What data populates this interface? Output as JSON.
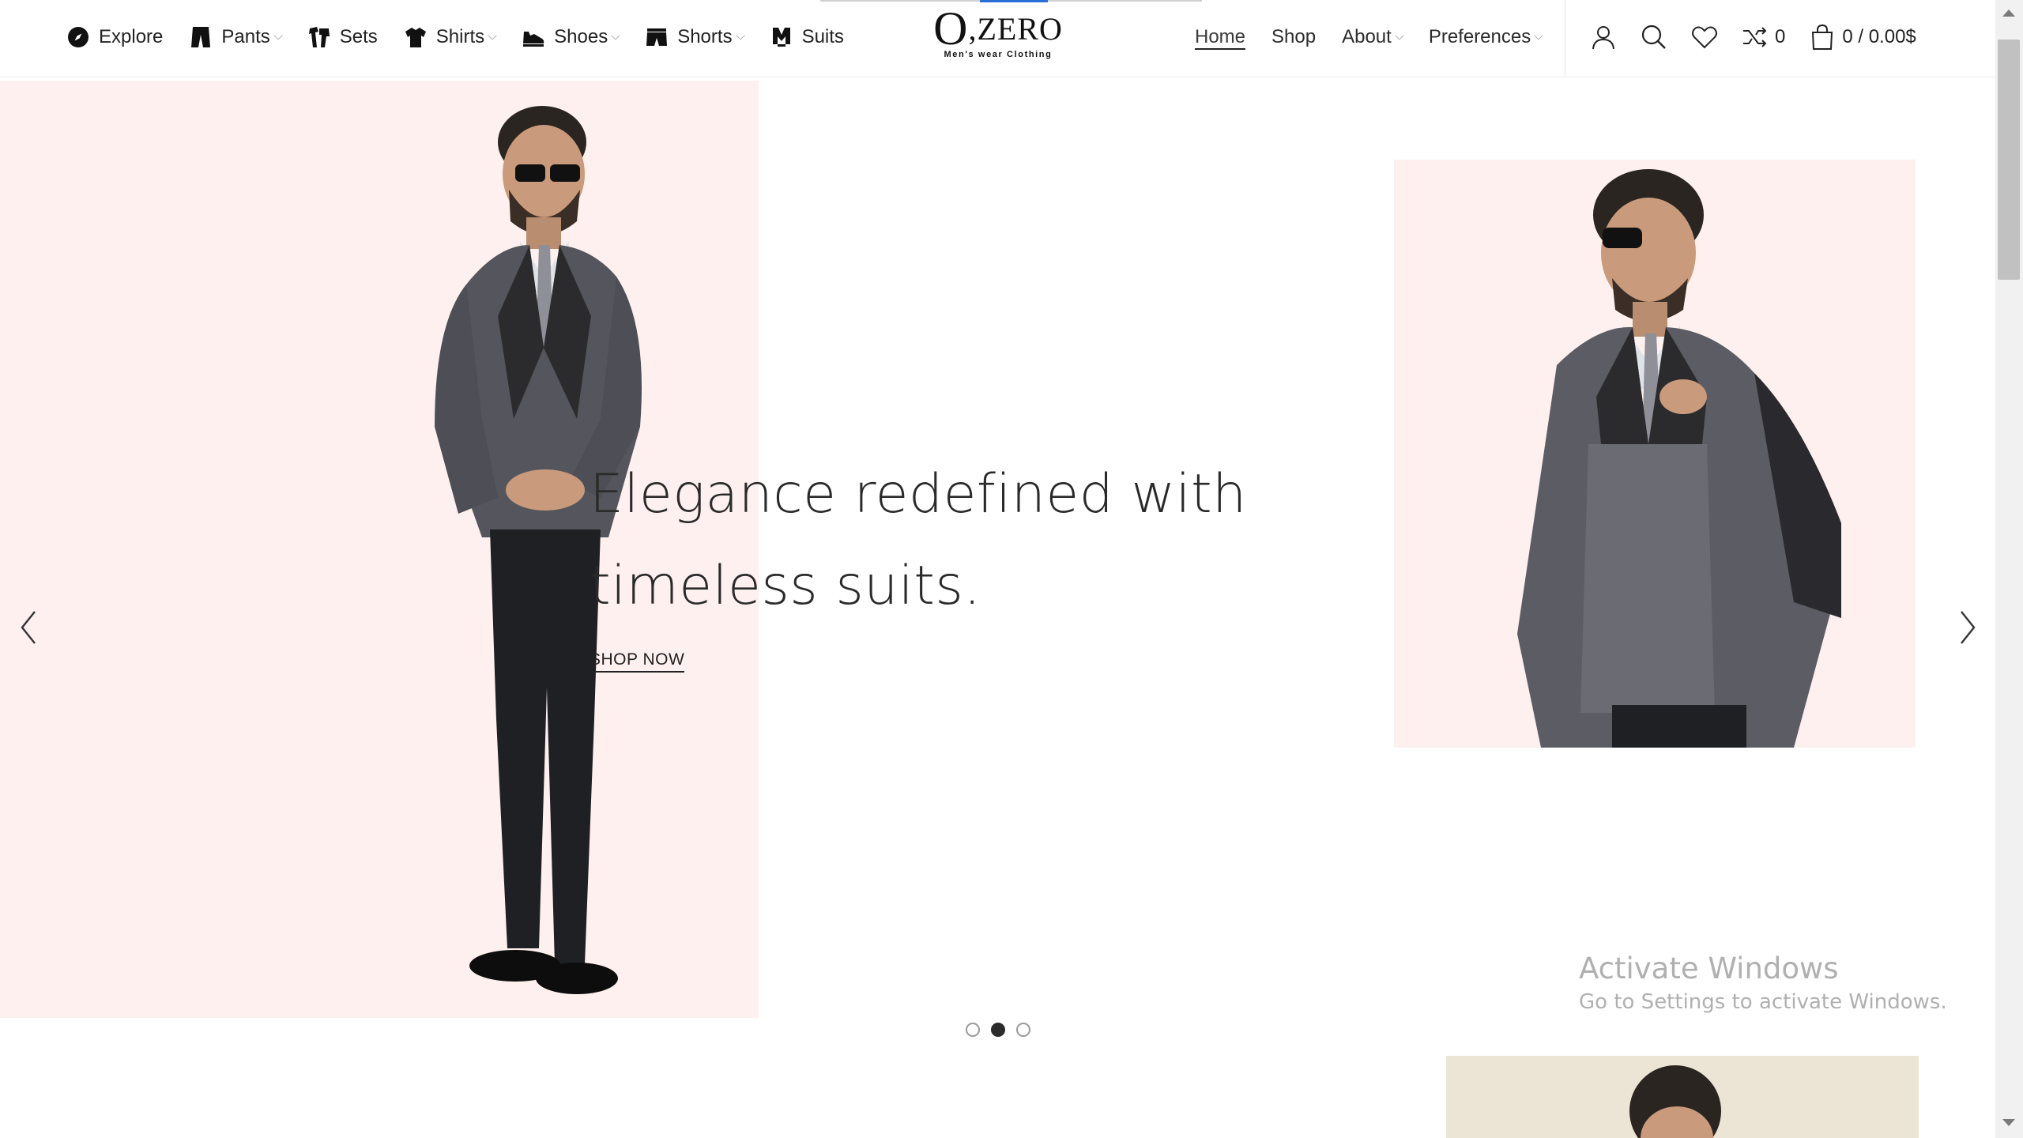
{
  "header": {
    "categories": [
      {
        "label": "Explore",
        "icon": "compass-icon",
        "dropdown": false
      },
      {
        "label": "Pants",
        "icon": "pants-icon",
        "dropdown": true
      },
      {
        "label": "Sets",
        "icon": "sets-icon",
        "dropdown": false
      },
      {
        "label": "Shirts",
        "icon": "shirt-icon",
        "dropdown": true
      },
      {
        "label": "Shoes",
        "icon": "shoe-icon",
        "dropdown": true
      },
      {
        "label": "Shorts",
        "icon": "shorts-icon",
        "dropdown": true
      },
      {
        "label": "Suits",
        "icon": "suit-icon",
        "dropdown": false
      }
    ],
    "logo": {
      "mark_o": "O",
      "mark_rest": ",ZERO",
      "tagline": "Men's wear Clothing"
    },
    "nav": [
      {
        "label": "Home",
        "active": true,
        "dropdown": false
      },
      {
        "label": "Shop",
        "active": false,
        "dropdown": false
      },
      {
        "label": "About",
        "active": false,
        "dropdown": true
      },
      {
        "label": "Preferences",
        "active": false,
        "dropdown": true
      }
    ],
    "tools": {
      "compare_count": "0",
      "cart_summary": "0 / 0.00$"
    }
  },
  "hero": {
    "title_line1": "Elegance redefined with",
    "title_line2": "timeless suits.",
    "cta": "SHOP NOW",
    "slide_count": 3,
    "active_slide": 2
  },
  "watermark": {
    "line1": "Activate Windows",
    "line2": "Go to Settings to activate Windows."
  },
  "colors": {
    "hero_bg": "#fdf0ee",
    "accent_progress": "#2a6fd8",
    "text": "#222222"
  }
}
